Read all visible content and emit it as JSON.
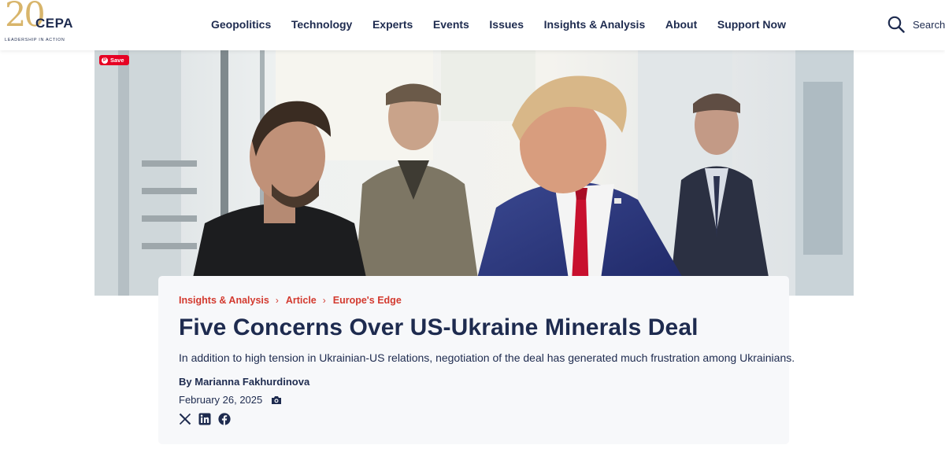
{
  "logo": {
    "number": "20",
    "name": "CEPA",
    "tagline": "LEADERSHIP IN ACTION"
  },
  "nav": {
    "items": [
      {
        "label": "Geopolitics"
      },
      {
        "label": "Technology"
      },
      {
        "label": "Experts"
      },
      {
        "label": "Events"
      },
      {
        "label": "Issues"
      },
      {
        "label": "Insights & Analysis"
      },
      {
        "label": "About"
      },
      {
        "label": "Support Now"
      }
    ]
  },
  "search": {
    "label": "Search",
    "icon": "search-icon"
  },
  "hero": {
    "save_label": "Save",
    "accent": "#e60023"
  },
  "article": {
    "breadcrumb": [
      "Insights & Analysis",
      "Article",
      "Europe's Edge"
    ],
    "title": "Five Concerns Over US-Ukraine Minerals Deal",
    "summary": "In addition to high tension in Ukrainian-US relations, negotiation of the deal has generated much frustration among Ukrainians.",
    "byline_prefix": "By",
    "author": "Marianna Fakhurdinova",
    "date": "February 26, 2025"
  },
  "social": {
    "icons": [
      "x-icon",
      "linkedin-icon",
      "facebook-icon"
    ]
  },
  "colors": {
    "brand_navy": "#1e2b4f",
    "accent_red": "#d33a2f",
    "logo_gold": "#d8b56b"
  }
}
